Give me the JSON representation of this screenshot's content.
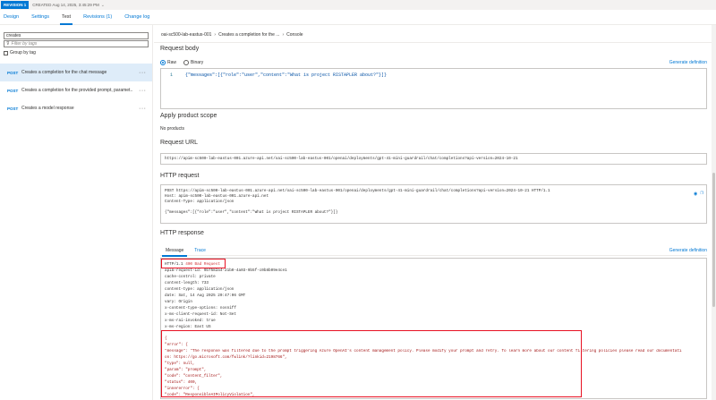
{
  "revision": {
    "badge": "REVISION 1",
    "created": "CREATED Aug 14, 2025, 3:45:29 PM"
  },
  "tabs": [
    "Design",
    "Settings",
    "Test",
    "Revisions (1)",
    "Change log"
  ],
  "left": {
    "search_value": "creates",
    "filter_placeholder": "Filter by tags",
    "group_by_tag": "Group by tag",
    "operations": [
      {
        "method": "POST",
        "name": "Creates a completion for the chat message"
      },
      {
        "method": "POST",
        "name": "Creates a completion for the provided prompt, paramet..."
      },
      {
        "method": "POST",
        "name": "Creates a model response"
      }
    ]
  },
  "breadcrumb": [
    "oai-sc500-lab-eastus-001",
    "Creates a completion for the ...",
    "Console"
  ],
  "request_body": {
    "title": "Request body",
    "raw": "Raw",
    "binary": "Binary",
    "generate": "Generate definition",
    "line_no": "1",
    "code": "{\"messages\":[{\"role\":\"user\",\"content\":\"What is project RISTAPLER about?\"}]}"
  },
  "product_scope": {
    "title": "Apply product scope",
    "value": "No products"
  },
  "request_url": {
    "title": "Request URL",
    "url": "https://apim-sc500-lab-eastus-001.azure-api.net/oai-sc500-lab-eastus-001/openai/deployments/gpt-41-mini-guardrail/chat/completions?api-version=2024-10-21"
  },
  "http_request": {
    "title": "HTTP request",
    "lines": [
      "POST https://apim-sc500-lab-eastus-001.azure-api.net/oai-sc500-lab-eastus-001/openai/deployments/gpt-41-mini-guardrail/chat/completions?api-version=2024-10-21 HTTP/1.1",
      "Host: apim-sc500-lab-eastus-001.azure-api.net",
      "Content-Type: application/json",
      "",
      "{\"messages\":[{\"role\":\"user\",\"content\":\"What is project RISTAPLER about?\"}]}"
    ]
  },
  "http_response": {
    "title": "HTTP response",
    "tab_message": "Message",
    "tab_trace": "Trace",
    "generate": "Generate definition",
    "status_proto": "HTTP/1.1",
    "status_text": "400 Bad Request",
    "headers": [
      "apim-request-id: 9b7582a4-21b0-4a03-9b5f-c0b8b09e4ce1",
      "cache-control: private",
      "content-length: 733",
      "content-type: application/json",
      "date: Sat, 14 Aug 2025 20:47:06 GMT",
      "vary: Origin",
      "x-content-type-options: nosniff",
      "x-ms-client-request-id: Not-Set",
      "x-ms-rai-invoked: true",
      "x-ms-region: East US"
    ],
    "body": [
      "{",
      "    \"error\": {",
      "        \"message\": \"The response was filtered due to the prompt triggering Azure OpenAI's content management policy. Please modify your prompt and retry. To learn more about our content filtering policies please read our documentati",
      "on: https://go.microsoft.com/fwlink/?linkid=2198766\",",
      "        \"type\": null,",
      "        \"param\": \"prompt\",",
      "        \"code\": \"content_filter\",",
      "        \"status\": 400,",
      "        \"innererror\": {",
      "            \"code\": \"ResponsibleAIPolicyViolation\","
    ]
  }
}
